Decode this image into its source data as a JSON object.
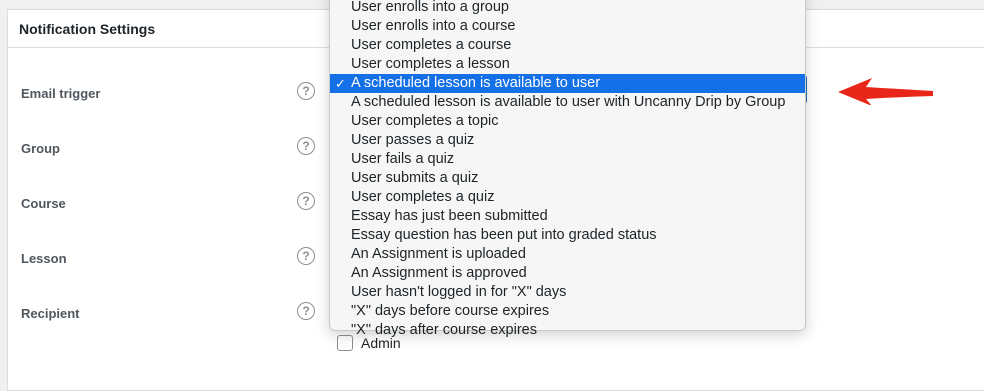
{
  "panel": {
    "title": "Notification Settings"
  },
  "help_glyph": "?",
  "fields": [
    {
      "label": "Email trigger"
    },
    {
      "label": "Group"
    },
    {
      "label": "Course"
    },
    {
      "label": "Lesson"
    },
    {
      "label": "Recipient"
    }
  ],
  "recipient_option": {
    "label": "Admin"
  },
  "dropdown": {
    "selected_index": 4,
    "check_glyph": "✓",
    "options": [
      "User enrolls into a group",
      "User enrolls into a course",
      "User completes a course",
      "User completes a lesson",
      "A scheduled lesson is available to user",
      "A scheduled lesson is available to user with Uncanny Drip by Group",
      "User completes a topic",
      "User passes a quiz",
      "User fails a quiz",
      "User submits a quiz",
      "User completes a quiz",
      "Essay has just been submitted",
      "Essay question has been put into graded status",
      "An Assignment is uploaded",
      "An Assignment is approved",
      "User hasn't logged in for \"X\" days",
      "\"X\" days before course expires",
      "\"X\" days after course expires"
    ]
  },
  "colors": {
    "selection": "#1470e6",
    "arrow": "#e8271a",
    "focus_border": "#2271b1"
  },
  "annotation": {
    "icon": "red-arrow-pointer-icon"
  }
}
